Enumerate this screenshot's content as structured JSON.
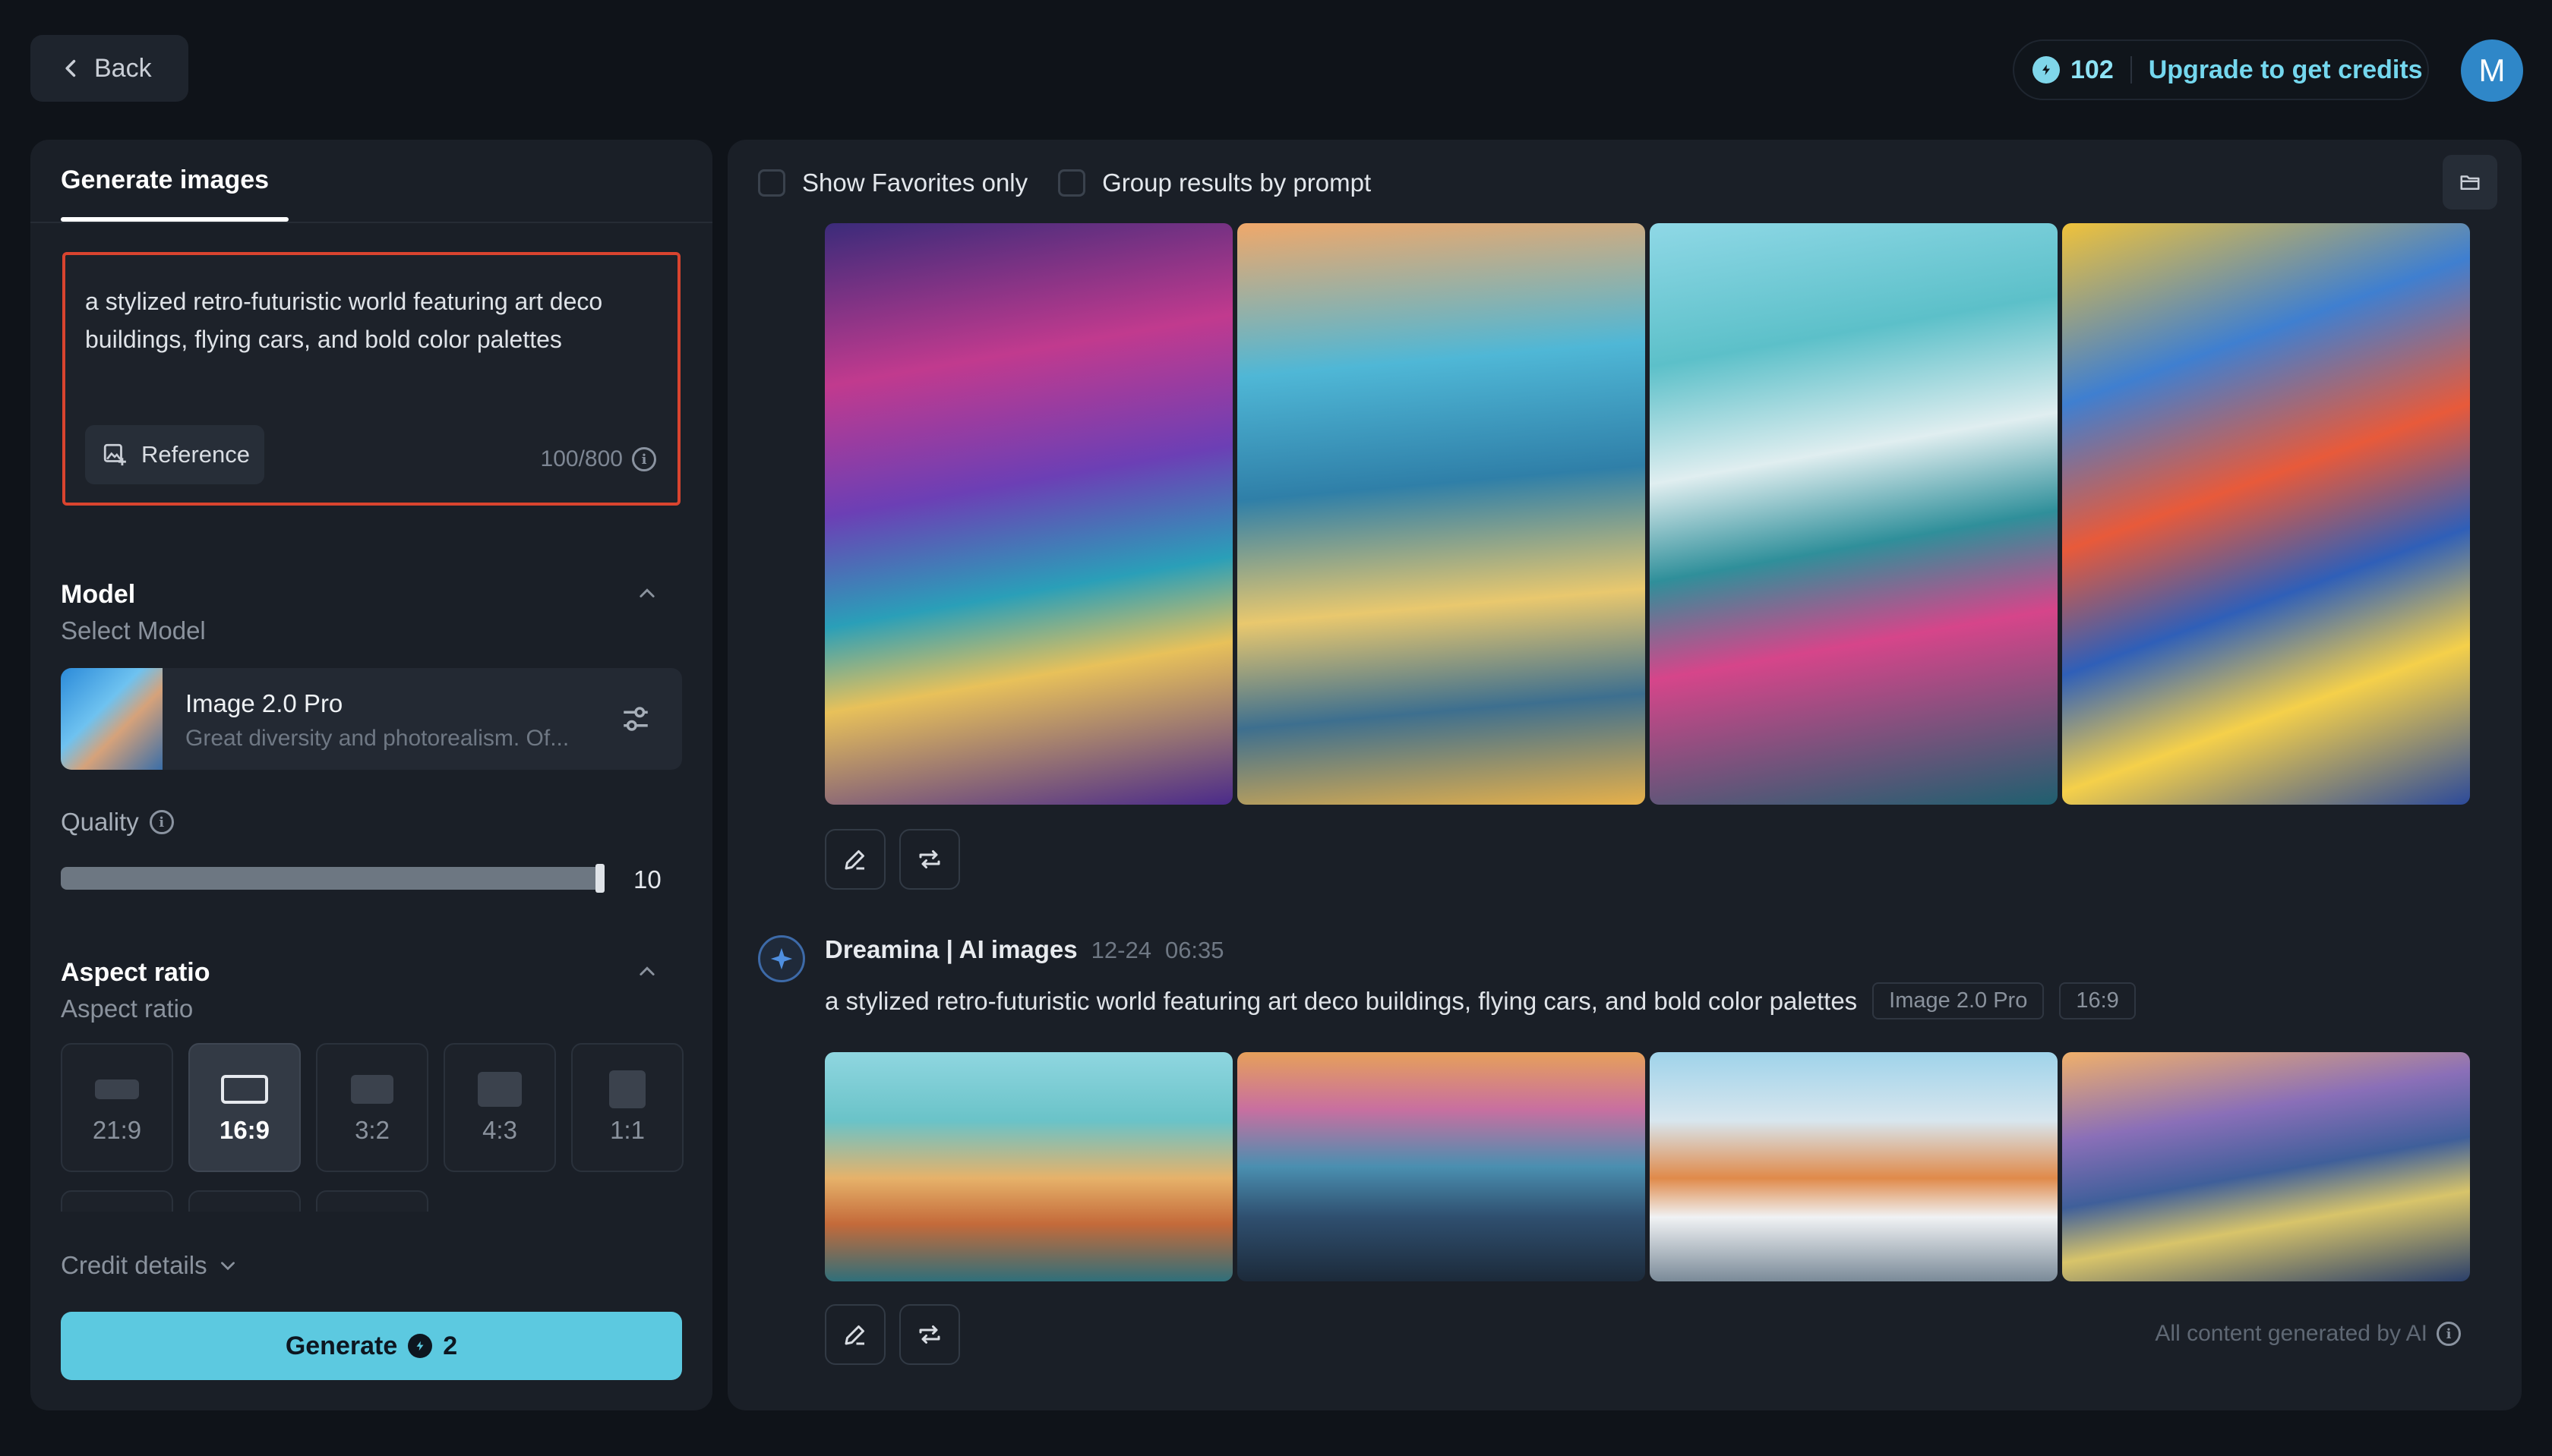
{
  "topbar": {
    "back_label": "Back",
    "credits": "102",
    "upgrade_label": "Upgrade to get credits",
    "avatar_initial": "M"
  },
  "panel": {
    "tab_label": "Generate images",
    "prompt_text": "a stylized retro-futuristic world featuring art deco buildings, flying cars, and bold color palettes",
    "reference_label": "Reference",
    "char_count": "100/800",
    "model_section": "Model",
    "select_model_label": "Select Model",
    "model_name": "Image 2.0 Pro",
    "model_desc": "Great diversity and photorealism. Of...",
    "quality_label": "Quality",
    "quality_value": "10",
    "quality_fraction": 1.0,
    "aspect_section": "Aspect ratio",
    "aspect_label": "Aspect ratio",
    "ratios": [
      {
        "label": "21:9",
        "selected": false
      },
      {
        "label": "16:9",
        "selected": true
      },
      {
        "label": "3:2",
        "selected": false
      },
      {
        "label": "4:3",
        "selected": false
      },
      {
        "label": "1:1",
        "selected": false
      }
    ],
    "credit_details_label": "Credit details",
    "generate_label": "Generate",
    "generate_cost": "2"
  },
  "results": {
    "show_favorites_label": "Show Favorites only",
    "group_by_prompt_label": "Group results by prompt",
    "author": "Dreamina | AI images",
    "date": "12-24",
    "time": "06:35",
    "prompt": "a stylized retro-futuristic world featuring art deco buildings, flying cars, and bold color palettes",
    "model_tag": "Image 2.0 Pro",
    "ratio_tag": "16:9",
    "ai_note": "All content generated by AI"
  },
  "colors": {
    "accent": "#5cc9e0",
    "highlight_border": "#d9442f",
    "background": "#0f1319",
    "panel": "#1a1f27"
  },
  "icons": [
    "chevron-left-icon",
    "credit-coin-icon",
    "reference-image-icon",
    "info-icon",
    "chevron-up-icon",
    "sliders-icon",
    "chevron-down-icon",
    "folder-icon",
    "edit-pencil-icon",
    "regenerate-icon",
    "dreamina-logo-icon"
  ]
}
